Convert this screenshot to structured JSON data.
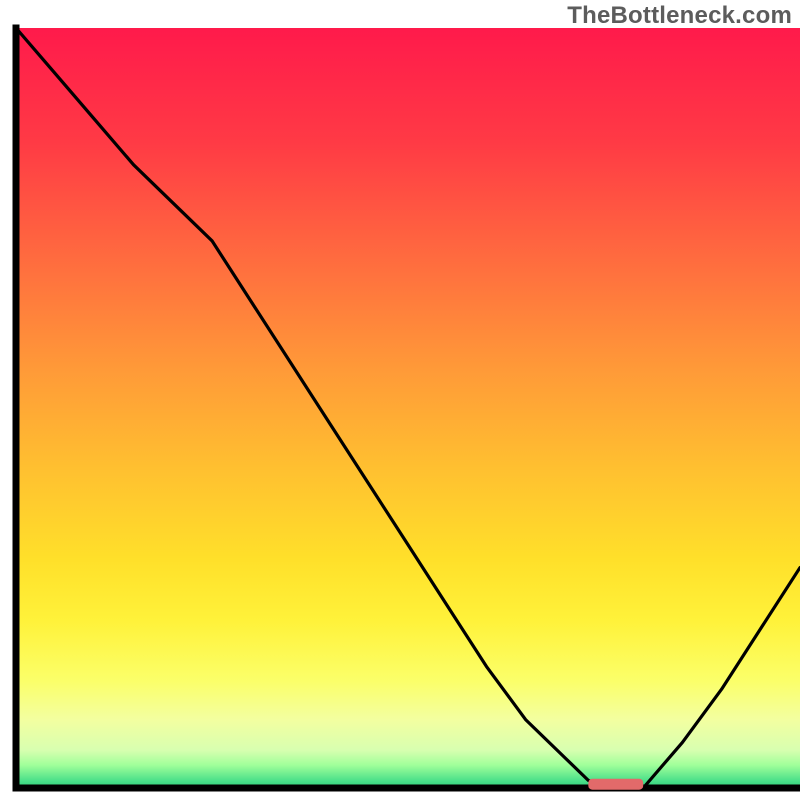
{
  "watermark": "TheBottleneck.com",
  "chart_data": {
    "type": "line",
    "title": "",
    "xlabel": "",
    "ylabel": "",
    "xlim": [
      0,
      100
    ],
    "ylim": [
      0,
      100
    ],
    "x": [
      0,
      5,
      10,
      15,
      20,
      25,
      30,
      35,
      40,
      45,
      50,
      55,
      60,
      65,
      70,
      73,
      76,
      78,
      80,
      85,
      90,
      95,
      100
    ],
    "values": [
      100,
      94,
      88,
      82,
      77,
      72,
      64,
      56,
      48,
      40,
      32,
      24,
      16,
      9,
      4,
      1,
      0,
      0,
      0,
      6,
      13,
      21,
      29
    ],
    "minimum_marker": {
      "x_start": 73,
      "x_end": 80,
      "y": 0.5,
      "color": "#e26a6a"
    },
    "gradient_stops": [
      {
        "offset": 0,
        "color": "#ff1a4b"
      },
      {
        "offset": 15,
        "color": "#ff3a45"
      },
      {
        "offset": 30,
        "color": "#ff6a3f"
      },
      {
        "offset": 45,
        "color": "#ff9a38"
      },
      {
        "offset": 58,
        "color": "#ffc030"
      },
      {
        "offset": 70,
        "color": "#ffe02a"
      },
      {
        "offset": 78,
        "color": "#fff23a"
      },
      {
        "offset": 86,
        "color": "#fbff6a"
      },
      {
        "offset": 91,
        "color": "#f3ffa0"
      },
      {
        "offset": 95,
        "color": "#d8ffb0"
      },
      {
        "offset": 97,
        "color": "#a0ff9a"
      },
      {
        "offset": 99,
        "color": "#4de08a"
      },
      {
        "offset": 100,
        "color": "#2ecf7a"
      }
    ],
    "line_color": "#000000",
    "axis_color": "#000000"
  }
}
